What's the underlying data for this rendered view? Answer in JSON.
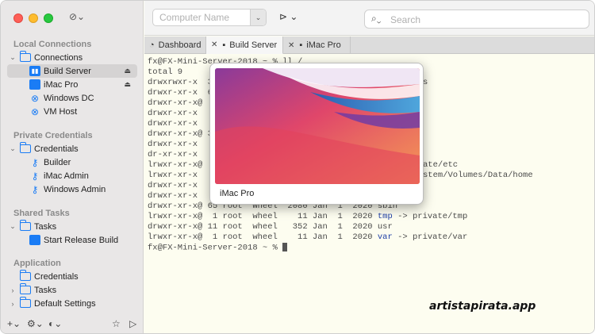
{
  "sidebar": {
    "sections": [
      {
        "title": "Local Connections"
      },
      {
        "title": "Private Credentials"
      },
      {
        "title": "Shared Tasks"
      },
      {
        "title": "Application"
      }
    ],
    "local": {
      "group": "Connections",
      "items": [
        "Build Server",
        "iMac Pro",
        "Windows DC",
        "VM Host"
      ]
    },
    "private": {
      "group": "Credentials",
      "items": [
        "Builder",
        "iMac Admin",
        "Windows Admin"
      ]
    },
    "shared": {
      "group": "Tasks",
      "items": [
        "Start Release Build"
      ]
    },
    "application": {
      "items": [
        "Credentials",
        "Tasks",
        "Default Settings"
      ]
    }
  },
  "toolbar": {
    "computer_name_placeholder": "Computer Name",
    "search_placeholder": "Search"
  },
  "tabs": [
    {
      "label": "Dashboard"
    },
    {
      "label": "Build Server"
    },
    {
      "label": "iMac Pro"
    }
  ],
  "terminal": {
    "lines": [
      "fx@FX-Mini-Server-2018 ~ % ll /",
      "total 9",
      "drwxrwxr-x  3",
      "drwxr-xr-x  6",
      "drwxr-xr-x@",
      "drwxr-xr-x",
      "drwxr-xr-x",
      "drwxr-xr-x@ 3",
      "drwxr-xr-x",
      "dr-xr-xr-x",
      "lrwxr-xr-x@",
      "lrwxr-xr-x",
      "drwxr-xr-x",
      "drwxr-xr-x",
      "drwxr-xr-x@ 65 root  wheel  2080 Jan  1  2020 sbin"
    ],
    "right_fragments": [
      "s",
      "ate/etc",
      "stem/Volumes/Data/home"
    ],
    "links": [
      {
        "prefix": "lrwxr-xr-x@  1 root  wheel    11 Jan  1  2020 ",
        "name": "tmp",
        "target": " -> private/tmp"
      },
      {
        "prefix": "drwxr-xr-x@ 11 root  wheel   352 Jan  1  2020 usr",
        "name": "",
        "target": ""
      },
      {
        "prefix": "lrwxr-xr-x@  1 root  wheel    11 Jan  1  2020 ",
        "name": "var",
        "target": " -> private/var"
      }
    ],
    "prompt": "fx@FX-Mini-Server-2018 ~ % "
  },
  "preview": {
    "caption": "iMac Pro"
  },
  "watermark": "artistapirata.app",
  "colors": {
    "accent": "#1a7cf5",
    "selection": "#d5d3d3"
  }
}
